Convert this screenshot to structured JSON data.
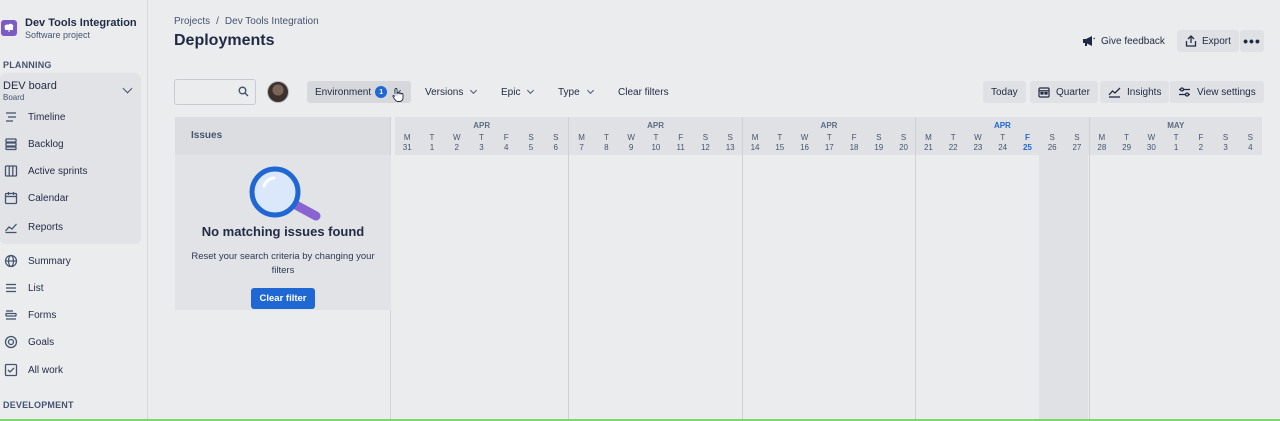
{
  "project": {
    "name": "Dev Tools Integration",
    "type": "Software project"
  },
  "sidebar": {
    "planning_heading": "PLANNING",
    "board": {
      "name": "DEV board",
      "sub": "Board"
    },
    "board_items": [
      {
        "label": "Timeline",
        "icon": "timeline-icon"
      },
      {
        "label": "Backlog",
        "icon": "backlog-icon"
      },
      {
        "label": "Active sprints",
        "icon": "board-icon"
      },
      {
        "label": "Calendar",
        "icon": "calendar-icon"
      },
      {
        "label": "Reports",
        "icon": "reports-icon"
      }
    ],
    "items": [
      {
        "label": "Summary",
        "icon": "globe-icon"
      },
      {
        "label": "List",
        "icon": "list-icon"
      },
      {
        "label": "Forms",
        "icon": "forms-icon"
      },
      {
        "label": "Goals",
        "icon": "goals-icon"
      },
      {
        "label": "All work",
        "icon": "all-work-icon"
      }
    ],
    "development_heading": "DEVELOPMENT"
  },
  "header": {
    "breadcrumb": [
      "Projects",
      "/",
      "Dev Tools Integration"
    ],
    "title": "Deployments",
    "feedback_label": "Give feedback",
    "export_label": "Export",
    "more_label": "•••"
  },
  "toolbar": {
    "search_placeholder": "",
    "filters": [
      {
        "label": "Environment",
        "count": "1"
      },
      {
        "label": "Versions"
      },
      {
        "label": "Epic"
      },
      {
        "label": "Type"
      }
    ],
    "clear_filters_label": "Clear filters",
    "today_label": "Today",
    "quarter_label": "Quarter",
    "insights_label": "Insights",
    "view_settings_label": "View settings"
  },
  "issues": {
    "header": "Issues",
    "empty_title": "No matching issues found",
    "empty_sub": "Reset your search criteria by changing your filters",
    "clear_button": "Clear filter"
  },
  "timeline": {
    "weeks": [
      {
        "month": "APR",
        "days": [
          [
            "M",
            "31"
          ],
          [
            "T",
            "1"
          ],
          [
            "W",
            "2"
          ],
          [
            "T",
            "3"
          ],
          [
            "F",
            "4"
          ],
          [
            "S",
            "5"
          ],
          [
            "S",
            "6"
          ]
        ]
      },
      {
        "month": "APR",
        "days": [
          [
            "M",
            "7"
          ],
          [
            "T",
            "8"
          ],
          [
            "W",
            "9"
          ],
          [
            "T",
            "10"
          ],
          [
            "F",
            "11"
          ],
          [
            "S",
            "12"
          ],
          [
            "S",
            "13"
          ]
        ]
      },
      {
        "month": "APR",
        "days": [
          [
            "M",
            "14"
          ],
          [
            "T",
            "15"
          ],
          [
            "W",
            "16"
          ],
          [
            "T",
            "17"
          ],
          [
            "F",
            "18"
          ],
          [
            "S",
            "19"
          ],
          [
            "S",
            "20"
          ]
        ]
      },
      {
        "month": "APR",
        "current": true,
        "days": [
          [
            "M",
            "21"
          ],
          [
            "T",
            "22"
          ],
          [
            "W",
            "23"
          ],
          [
            "T",
            "24"
          ],
          [
            "F",
            "25"
          ],
          [
            "S",
            "26"
          ],
          [
            "S",
            "27"
          ]
        ]
      },
      {
        "month": "MAY",
        "days": [
          [
            "M",
            "28"
          ],
          [
            "T",
            "29"
          ],
          [
            "W",
            "30"
          ],
          [
            "T",
            "1"
          ],
          [
            "F",
            "2"
          ],
          [
            "S",
            "3"
          ],
          [
            "S",
            "4"
          ]
        ]
      }
    ],
    "today": "25"
  },
  "colors": {
    "accent": "#1f67d2",
    "brand": "#7b5cc4"
  }
}
